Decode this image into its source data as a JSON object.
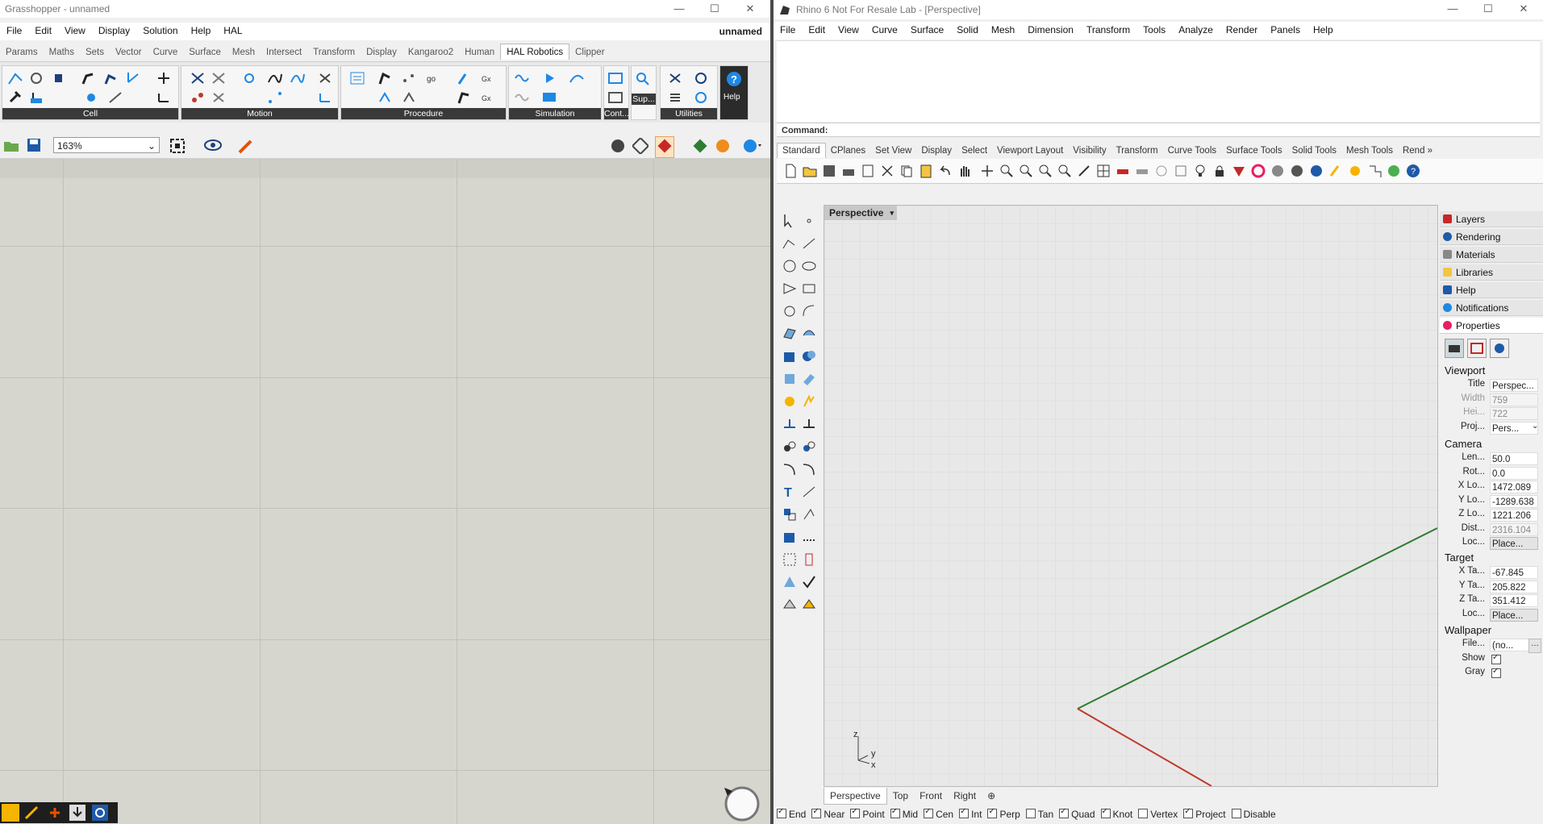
{
  "gh": {
    "title": "Grasshopper - unnamed",
    "doc_name": "unnamed",
    "menu": [
      "File",
      "Edit",
      "View",
      "Display",
      "Solution",
      "Help",
      "HAL"
    ],
    "tabs": [
      "Params",
      "Maths",
      "Sets",
      "Vector",
      "Curve",
      "Surface",
      "Mesh",
      "Intersect",
      "Transform",
      "Display",
      "Kangaroo2",
      "Human",
      "HAL Robotics",
      "Clipper"
    ],
    "active_tab": "HAL Robotics",
    "panels": [
      "Cell",
      "Motion",
      "Procedure",
      "Simulation",
      "Cont...",
      "Utilities"
    ],
    "sup_label": "Sup...",
    "help_label": "Help",
    "zoom": "163%"
  },
  "rhino": {
    "title": "Rhino 6 Not For Resale Lab - [Perspective]",
    "menu": [
      "File",
      "Edit",
      "View",
      "Curve",
      "Surface",
      "Solid",
      "Mesh",
      "Dimension",
      "Transform",
      "Tools",
      "Analyze",
      "Render",
      "Panels",
      "Help"
    ],
    "command_label": "Command:",
    "toolbar_tabs": [
      "Standard",
      "CPlanes",
      "Set View",
      "Display",
      "Select",
      "Viewport Layout",
      "Visibility",
      "Transform",
      "Curve Tools",
      "Surface Tools",
      "Solid Tools",
      "Mesh Tools",
      "Rend »"
    ],
    "viewport_name": "Perspective",
    "view_tabs": [
      "Perspective",
      "Top",
      "Front",
      "Right"
    ],
    "osnaps": [
      {
        "label": "End",
        "checked": true
      },
      {
        "label": "Near",
        "checked": true
      },
      {
        "label": "Point",
        "checked": true
      },
      {
        "label": "Mid",
        "checked": true
      },
      {
        "label": "Cen",
        "checked": true
      },
      {
        "label": "Int",
        "checked": true
      },
      {
        "label": "Perp",
        "checked": true
      },
      {
        "label": "Tan",
        "checked": false
      },
      {
        "label": "Quad",
        "checked": true
      },
      {
        "label": "Knot",
        "checked": true
      },
      {
        "label": "Vertex",
        "checked": false
      },
      {
        "label": "Project",
        "checked": true
      },
      {
        "label": "Disable",
        "checked": false
      }
    ],
    "axis_labels": {
      "z": "z",
      "y": "y",
      "x": "x"
    },
    "panel_tabs": [
      "Layers",
      "Rendering",
      "Materials",
      "Libraries",
      "Help",
      "Notifications",
      "Properties"
    ],
    "properties": {
      "viewport_section": "Viewport",
      "viewport": [
        {
          "k": "Title",
          "v": "Perspec..."
        },
        {
          "k": "Width",
          "v": "759"
        },
        {
          "k": "Hei...",
          "v": "722"
        },
        {
          "k": "Proj...",
          "v": "Pers..."
        }
      ],
      "camera_section": "Camera",
      "camera": [
        {
          "k": "Len...",
          "v": "50.0"
        },
        {
          "k": "Rot...",
          "v": "0.0"
        },
        {
          "k": "X Lo...",
          "v": "1472.089"
        },
        {
          "k": "Y Lo...",
          "v": "-1289.638"
        },
        {
          "k": "Z Lo...",
          "v": "1221.206"
        },
        {
          "k": "Dist...",
          "v": "2316.104"
        },
        {
          "k": "Loc...",
          "v": "Place..."
        }
      ],
      "target_section": "Target",
      "target": [
        {
          "k": "X Ta...",
          "v": "-67.845"
        },
        {
          "k": "Y Ta...",
          "v": "205.822"
        },
        {
          "k": "Z Ta...",
          "v": "351.412"
        },
        {
          "k": "Loc...",
          "v": "Place..."
        }
      ],
      "wallpaper_section": "Wallpaper",
      "wallpaper": [
        {
          "k": "File...",
          "v": "(no..."
        },
        {
          "k": "Show",
          "v": ""
        },
        {
          "k": "Gray",
          "v": ""
        }
      ]
    }
  },
  "colors": {
    "x_axis": "#c0392b",
    "y_axis": "#2e7d32",
    "accent": "#1e88e5"
  }
}
